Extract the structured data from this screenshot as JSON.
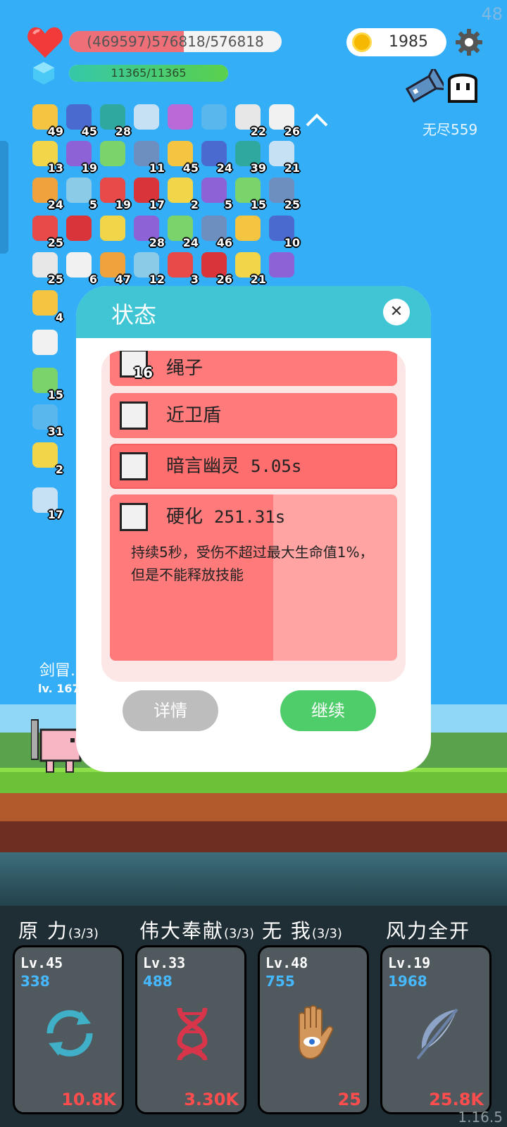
{
  "hud": {
    "fps": "48",
    "hp_text": "(469597)576818/576818",
    "hp_fraction": 0.54,
    "mp_text": "11365/11365",
    "mp_fraction": 1.0,
    "coins": "1985",
    "endless": "无尽559"
  },
  "buffs_row1": [
    "49",
    "45",
    "28",
    "",
    "",
    "",
    "22",
    "26"
  ],
  "buffs_row2": [
    "13",
    "19",
    "",
    "11",
    "45",
    "24",
    "39",
    "21"
  ],
  "buffs_row3": [
    "24",
    "5",
    "19",
    "17",
    "2",
    "5",
    "15",
    "25"
  ],
  "buffs_row4": [
    "25",
    "",
    "",
    "28",
    "24",
    "46",
    "",
    "10"
  ],
  "buffs_row5": [
    "25",
    "6",
    "47",
    "12",
    "3",
    "26",
    "21",
    ""
  ],
  "buffs_col": [
    "4",
    "",
    "15",
    "31",
    "2",
    "17"
  ],
  "player": {
    "name": "剑冒...",
    "level": "lv. 167"
  },
  "modal": {
    "title": "状态",
    "close": "✕",
    "rows": [
      {
        "name": "绳子",
        "level": "16",
        "timer": ""
      },
      {
        "name": "近卫盾",
        "level": "",
        "timer": ""
      },
      {
        "name": "暗言幽灵",
        "level": "",
        "timer": "5.05s"
      },
      {
        "name": "硬化",
        "level": "",
        "timer": "251.31s",
        "desc": "持续5秒，受伤不超过最大生命值1%，但是不能释放技能"
      }
    ],
    "btn_detail": "详情",
    "btn_continue": "继续"
  },
  "skills": [
    {
      "title": "原 力",
      "uses": "(3/3)",
      "level": "Lv.45",
      "mp": "338",
      "cost": "10.8K",
      "icon": "cycle-icon"
    },
    {
      "title": "伟大奉献",
      "uses": "(3/3)",
      "level": "Lv.33",
      "mp": "488",
      "cost": "3.30K",
      "icon": "dna-icon"
    },
    {
      "title": "无 我",
      "uses": "(3/3)",
      "level": "Lv.48",
      "mp": "755",
      "cost": "25",
      "icon": "eye-hand-icon"
    },
    {
      "title": "风力全开",
      "uses": "",
      "level": "Lv.19",
      "mp": "1968",
      "cost": "25.8K",
      "icon": "feather-icon"
    }
  ],
  "version": "1.16.5",
  "colors": {
    "sky": "#33aef7",
    "modal_header": "#3fc5d3",
    "row": "#ff7b7b",
    "continue": "#4fcd6a"
  }
}
